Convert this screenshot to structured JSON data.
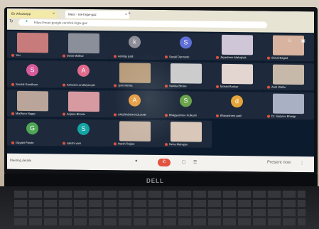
{
  "browser": {
    "tab1_label": "Ek WhatsApp",
    "tab2_label": "Meet - txk-hrgw-gaz",
    "address": "https://meet.google.com/txk-hrgw-gaz"
  },
  "participants": [
    {
      "name": "You",
      "type": "video",
      "color": "#c77b7b"
    },
    {
      "name": "Swati Malikar",
      "type": "video",
      "color": "#8a8f99"
    },
    {
      "name": "Ashitija patil",
      "type": "avatar",
      "initial": "k",
      "color": "#8e8e99"
    },
    {
      "name": "Sayali Darmode",
      "type": "avatar",
      "initial": "S",
      "color": "#5f6fd8"
    },
    {
      "name": "Jayashree Mahajhsk",
      "type": "video",
      "color": "#cfc6d8"
    },
    {
      "name": "Shruti Bagad",
      "type": "video",
      "color": "#d8b4a0"
    },
    {
      "name": "Srushti Gandhure",
      "type": "avatar",
      "initial": "S",
      "color": "#d65b9b"
    },
    {
      "name": "Ashwini Londhepimple",
      "type": "avatar",
      "initial": "A",
      "color": "#e06b8c"
    },
    {
      "name": "Jyoti Mehta",
      "type": "video",
      "color": "#b89d7c"
    },
    {
      "name": "Sanika Bhoke",
      "type": "video",
      "color": "#ccc"
    },
    {
      "name": "Mohini Bankar",
      "type": "video",
      "color": "#e3d6d0"
    },
    {
      "name": "Aarti Walke",
      "type": "video",
      "color": "#c7b9a9"
    },
    {
      "name": "Madhura Nagar",
      "type": "video",
      "color": "#b9a599"
    },
    {
      "name": "Anjana Bhosle",
      "type": "video",
      "color": "#d89aa1"
    },
    {
      "name": "ANURADHA KOLHAR",
      "type": "avatar",
      "initial": "A",
      "color": "#e49a3d"
    },
    {
      "name": "Bhagyashree Kulkarni",
      "type": "avatar",
      "initial": "S",
      "color": "#6ba34c"
    },
    {
      "name": "Bhavashree patil",
      "type": "avatar",
      "initial": "d",
      "color": "#e5a53a"
    },
    {
      "name": "Dr. Sanjeev Bhadgi",
      "type": "video",
      "color": "#aab0c4"
    },
    {
      "name": "Gayatri Pande",
      "type": "avatar",
      "initial": "G",
      "color": "#4fa656"
    },
    {
      "name": "sakshi vare",
      "type": "avatar",
      "initial": "S",
      "color": "#16a5a5"
    },
    {
      "name": "Harsh Rajput",
      "type": "video",
      "color": "#c9b5a5"
    },
    {
      "name": "Neha Mahajan",
      "type": "video",
      "color": "#d9c8ba"
    }
  ],
  "controls": {
    "meeting_details": "Meeting details",
    "end_call": "✆",
    "present_label": "Present now"
  },
  "brand": "DELL"
}
